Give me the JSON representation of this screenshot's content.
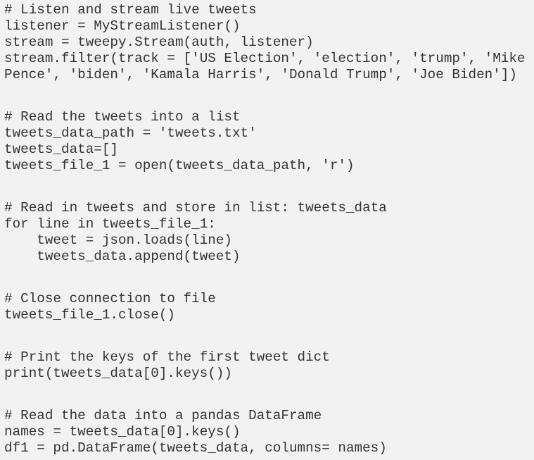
{
  "colors": {
    "background": "#f2f2f2",
    "text": "#333333"
  },
  "code": {
    "language": "python",
    "sections": [
      {
        "lines": [
          "# Listen and stream live tweets",
          "listener = MyStreamListener()",
          "stream = tweepy.Stream(auth, listener)",
          "stream.filter(track = ['US Election', 'election', 'trump', 'Mike",
          "Pence', 'biden', 'Kamala Harris', 'Donald Trump', 'Joe Biden'])"
        ]
      },
      {
        "lines": [
          "# Read the tweets into a list",
          "tweets_data_path = 'tweets.txt'",
          "tweets_data=[]",
          "tweets_file_1 = open(tweets_data_path, 'r')"
        ]
      },
      {
        "lines": [
          "# Read in tweets and store in list: tweets_data",
          "for line in tweets_file_1:",
          "    tweet = json.loads(line)",
          "    tweets_data.append(tweet)"
        ]
      },
      {
        "lines": [
          "# Close connection to file",
          "tweets_file_1.close()"
        ]
      },
      {
        "lines": [
          "# Print the keys of the first tweet dict",
          "print(tweets_data[0].keys())"
        ]
      },
      {
        "lines": [
          "# Read the data into a pandas DataFrame",
          "names = tweets_data[0].keys()",
          "df1 = pd.DataFrame(tweets_data, columns= names)"
        ]
      }
    ]
  }
}
